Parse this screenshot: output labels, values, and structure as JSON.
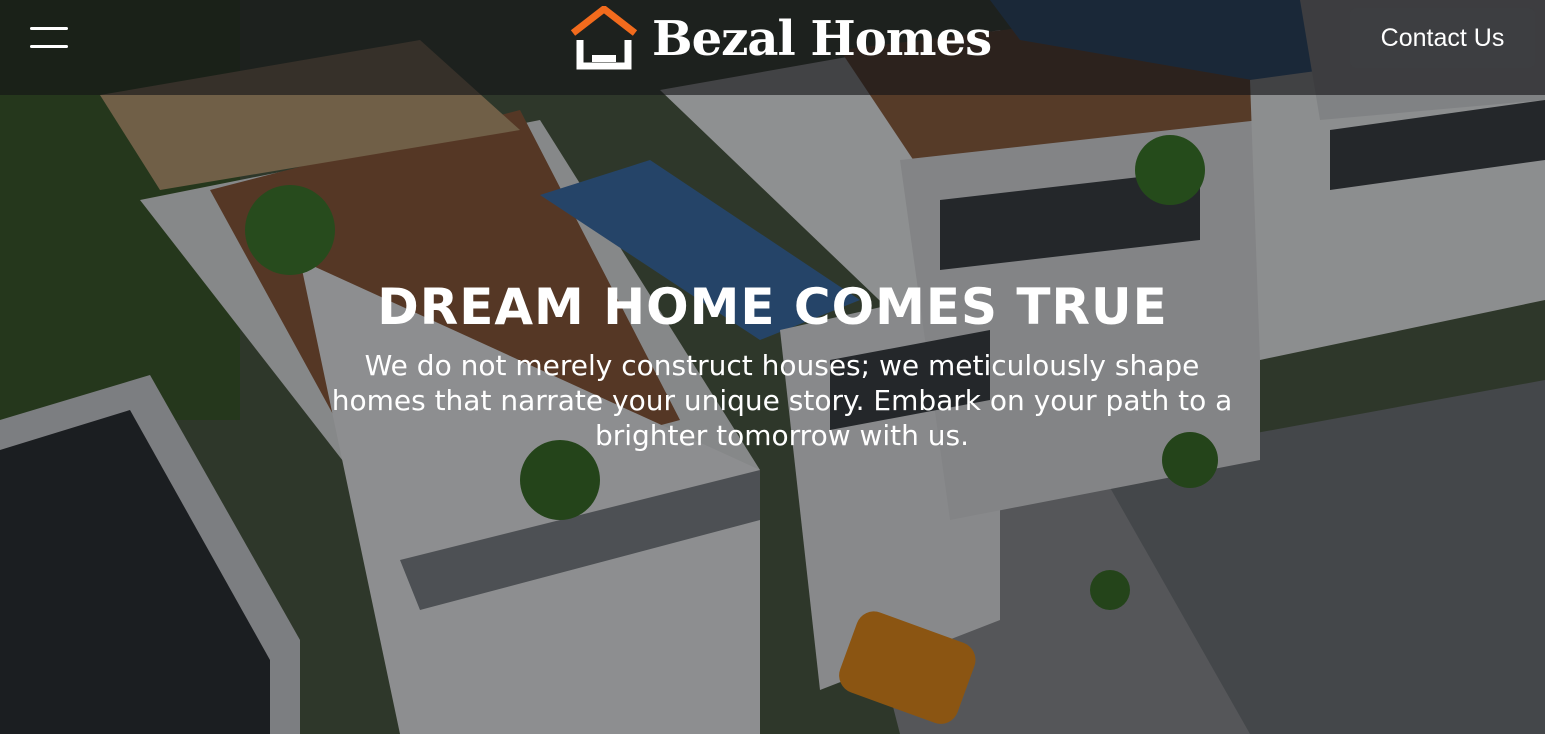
{
  "header": {
    "menu_icon": "hamburger-menu-icon",
    "logo": {
      "icon": "house-roof-icon",
      "text": "Bezal Homes",
      "roof_color": "#f26b1d"
    },
    "contact_label": "Contact Us"
  },
  "hero": {
    "headline": "DREAM HOME COMES TRUE",
    "subtext": "We do not merely construct houses; we meticulously shape homes that narrate your unique story. Embark on your path to a brighter tomorrow with us.",
    "image_subject": "aerial rendering of modern white townhouses with rooftop terraces and pools"
  }
}
